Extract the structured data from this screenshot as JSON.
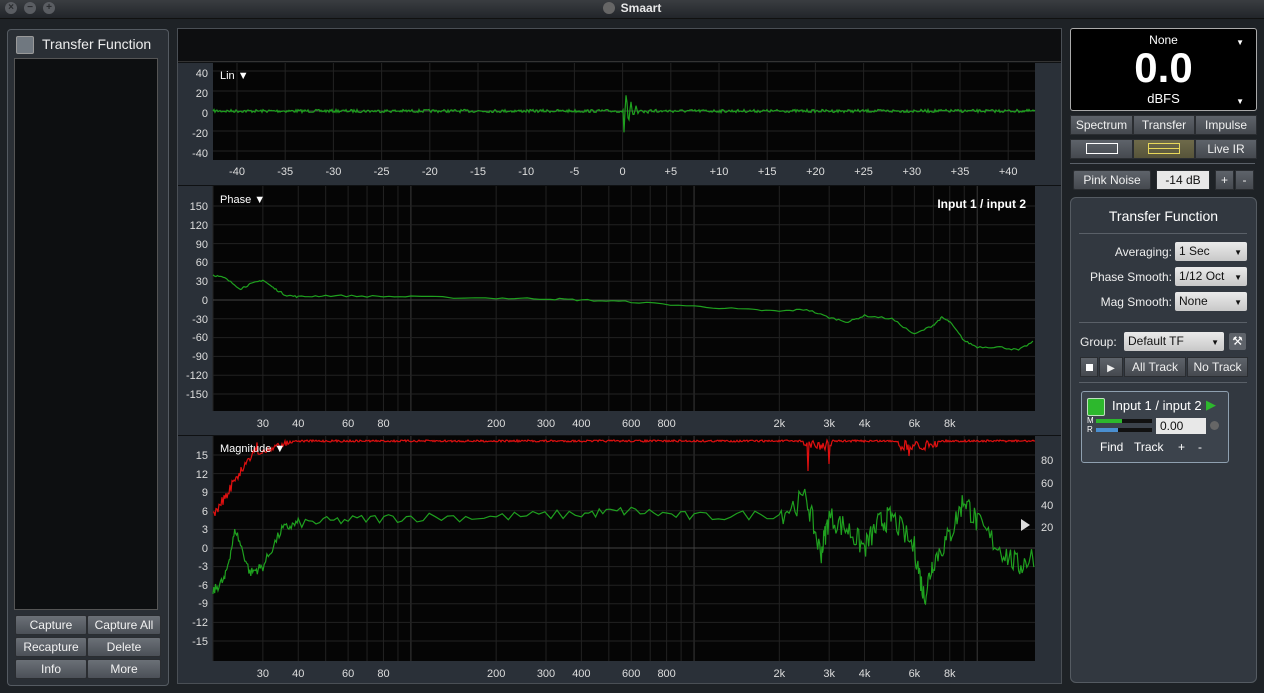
{
  "window": {
    "title": "Smaart"
  },
  "left_panel": {
    "title": "Transfer Function",
    "buttons": {
      "capture": "Capture",
      "capture_all": "Capture All",
      "recapture": "Recapture",
      "delete": "Delete",
      "info": "Info",
      "more": "More"
    }
  },
  "impulse": {
    "scale_label": "Lin ▼",
    "y_ticks": [
      "40",
      "20",
      "0",
      "-20",
      "-40"
    ],
    "x_ticks": [
      "-40",
      "-35",
      "-30",
      "-25",
      "-20",
      "-15",
      "-10",
      "-5",
      "0",
      "+5",
      "+10",
      "+15",
      "+20",
      "+25",
      "+30",
      "+35",
      "+40"
    ]
  },
  "phase": {
    "label": "Phase ▼",
    "trace_label": "Input 1 / input 2",
    "y_ticks": [
      "150",
      "120",
      "90",
      "60",
      "30",
      "0",
      "-30",
      "-60",
      "-90",
      "-120",
      "-150"
    ],
    "x_ticks": [
      "30",
      "40",
      "60",
      "80",
      "200",
      "300",
      "400",
      "600",
      "800",
      "2k",
      "3k",
      "4k",
      "6k",
      "8k"
    ]
  },
  "magnitude": {
    "label": "Magnitude ▼",
    "y_ticks": [
      "15",
      "12",
      "9",
      "6",
      "3",
      "0",
      "-3",
      "-6",
      "-9",
      "-12",
      "-15"
    ],
    "coherence_ticks": [
      "80",
      "60",
      "40",
      "20"
    ],
    "x_ticks": [
      "30",
      "40",
      "60",
      "80",
      "200",
      "300",
      "400",
      "600",
      "800",
      "2k",
      "3k",
      "4k",
      "6k",
      "8k"
    ]
  },
  "meter": {
    "source": "None",
    "value": "0.0",
    "unit": "dBFS"
  },
  "modes": {
    "spectrum": "Spectrum",
    "transfer": "Transfer",
    "impulse": "Impulse",
    "live_ir": "Live IR"
  },
  "generator": {
    "label": "Pink Noise",
    "level": "-14 dB",
    "plus": "+",
    "minus": "-"
  },
  "tf_panel": {
    "title": "Transfer Function",
    "averaging_label": "Averaging:",
    "averaging_value": "1 Sec",
    "phase_smooth_label": "Phase Smooth:",
    "phase_smooth_value": "1/12 Oct",
    "mag_smooth_label": "Mag Smooth:",
    "mag_smooth_value": "None",
    "group_label": "Group:",
    "group_value": "Default TF",
    "all_track": "All Track",
    "no_track": "No Track",
    "measurement": {
      "name": "Input 1 / input 2",
      "m": "M",
      "r": "R",
      "delay": "0.00",
      "find": "Find",
      "track": "Track",
      "plus": "+",
      "minus": "-"
    }
  },
  "colors": {
    "trace": "#1fa01f",
    "coherence": "#e01010",
    "grid": "#2a2a2a",
    "background": "#050505"
  }
}
